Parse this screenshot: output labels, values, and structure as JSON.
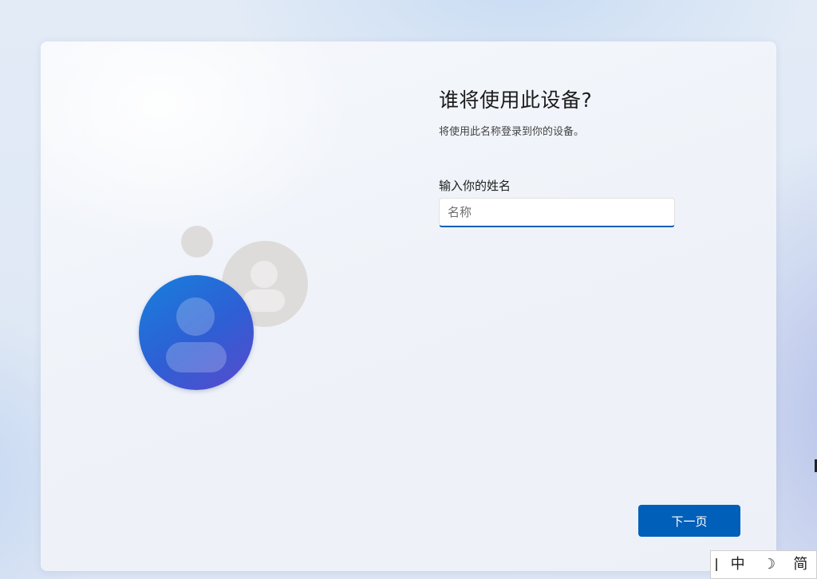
{
  "setup": {
    "title": "谁将使用此设备?",
    "subtitle": "将使用此名称登录到你的设备。",
    "name_field": {
      "label": "输入你的姓名",
      "placeholder": "名称",
      "value": ""
    },
    "next_button_label": "下一页"
  },
  "ime_bar": {
    "mode_label": "中",
    "moon_glyph": "☽",
    "script_label": "简"
  },
  "colors": {
    "accent": "#005fb8",
    "avatar_blue": "#2f5ed4",
    "avatar_gray": "#dedcdb"
  }
}
